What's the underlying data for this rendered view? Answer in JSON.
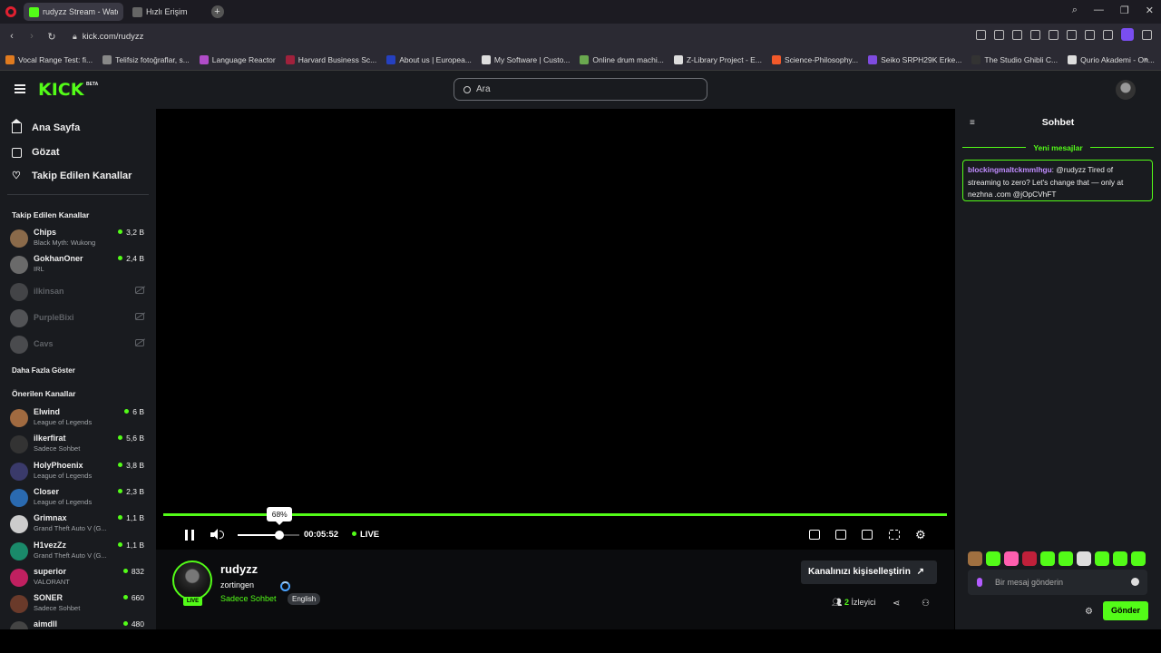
{
  "browser": {
    "tabs": [
      {
        "label": "rudyzz Stream - Watc",
        "color": "#53fc18"
      },
      {
        "label": "Hızlı Erişim",
        "color": "#666666"
      }
    ],
    "url": "kick.com/rudyzz",
    "bookmarks": [
      {
        "label": "Vocal Range Test: fi...",
        "color": "#e07a1f"
      },
      {
        "label": "Telifsiz fotoğraflar, s...",
        "color": "#888888"
      },
      {
        "label": "Language Reactor",
        "color": "#b04cc8"
      },
      {
        "label": "Harvard Business Sc...",
        "color": "#a0213c"
      },
      {
        "label": "About us | Europea...",
        "color": "#2540c0"
      },
      {
        "label": "My Software | Custo...",
        "color": "#dddddd"
      },
      {
        "label": "Online drum machi...",
        "color": "#6aa84f"
      },
      {
        "label": "Z-Library Project - E...",
        "color": "#dddddd"
      },
      {
        "label": "Science-Philosophy...",
        "color": "#f2592a"
      },
      {
        "label": "Seiko SRPH29K Erke...",
        "color": "#7f4be0"
      },
      {
        "label": "The Studio Ghibli C...",
        "color": "#333333"
      },
      {
        "label": "Qurio Akademi - On...",
        "color": "#dddddd"
      }
    ]
  },
  "header": {
    "logo": "KICK",
    "beta": "BETA",
    "search_placeholder": "Ara"
  },
  "sidebar": {
    "nav": [
      "Ana Sayfa",
      "Gözat",
      "Takip Edilen Kanallar"
    ],
    "followed_title": "Takip Edilen Kanallar",
    "followed": [
      {
        "name": "Chips",
        "category": "Black Myth: Wukong",
        "viewers": "3,2 B",
        "online": true,
        "color": "#8a6a4a"
      },
      {
        "name": "GokhanOner",
        "category": "IRL",
        "viewers": "2,4 B",
        "online": true,
        "color": "#6a6a6a"
      },
      {
        "name": "ilkinsan",
        "online": false,
        "color": "#777777"
      },
      {
        "name": "PurpleBixi",
        "online": false,
        "color": "#999999"
      },
      {
        "name": "Cavs",
        "online": false,
        "color": "#888888"
      }
    ],
    "more": "Daha Fazla Göster",
    "recommended_title": "Önerilen Kanallar",
    "recommended": [
      {
        "name": "Elwind",
        "category": "League of Legends",
        "viewers": "6 B",
        "color": "#a06a40"
      },
      {
        "name": "ilkerfirat",
        "category": "Sadece Sohbet",
        "viewers": "5,6 B",
        "color": "#333333"
      },
      {
        "name": "HolyPhoenix",
        "category": "League of Legends",
        "viewers": "3,8 B",
        "color": "#3a3a6a"
      },
      {
        "name": "Closer",
        "category": "League of Legends",
        "viewers": "2,3 B",
        "color": "#2a6ab0"
      },
      {
        "name": "Grimnax",
        "category": "Grand Theft Auto V (G...",
        "viewers": "1,1 B",
        "color": "#cccccc"
      },
      {
        "name": "H1vezZz",
        "category": "Grand Theft Auto V (G...",
        "viewers": "1,1 B",
        "color": "#1a8a6a"
      },
      {
        "name": "superior",
        "category": "VALORANT",
        "viewers": "832",
        "color": "#c02060"
      },
      {
        "name": "SONER",
        "category": "Sadece Sohbet",
        "viewers": "660",
        "color": "#6a3a2a"
      },
      {
        "name": "aimdll",
        "category": "",
        "viewers": "480",
        "color": "#444444"
      }
    ]
  },
  "player": {
    "progress": 1.0,
    "volume_percent": 68,
    "volume_label": "68%",
    "time": "00:05:52",
    "live_label": "LIVE"
  },
  "stream": {
    "streamer": "rudyzz",
    "title": "zortingen",
    "category": "Sadece Sohbet",
    "language": "English",
    "live_badge": "LIVE",
    "customize_label": "Kanalınızı kişiselleştirin",
    "viewer_count": "2",
    "viewer_label": "İzleyici"
  },
  "chat": {
    "title": "Sohbet",
    "new_messages": "Yeni mesajlar",
    "message_user": "blockingmaltckmmlhgu",
    "message_text": ": @rudyzz Tired of streaming to zero? Let's change that — only at nezhna .com @jOpCVhFT",
    "input_placeholder": "Bir mesaj gönderin",
    "send_label": "Gönder",
    "emote_colors": [
      "#a07040",
      "#53fc18",
      "#ff5fb0",
      "#c0203a",
      "#53fc18",
      "#53fc18",
      "#dddddd",
      "#53fc18",
      "#53fc18",
      "#53fc18"
    ]
  },
  "colors": {
    "accent": "#53fc18",
    "background": "#191b1f"
  }
}
